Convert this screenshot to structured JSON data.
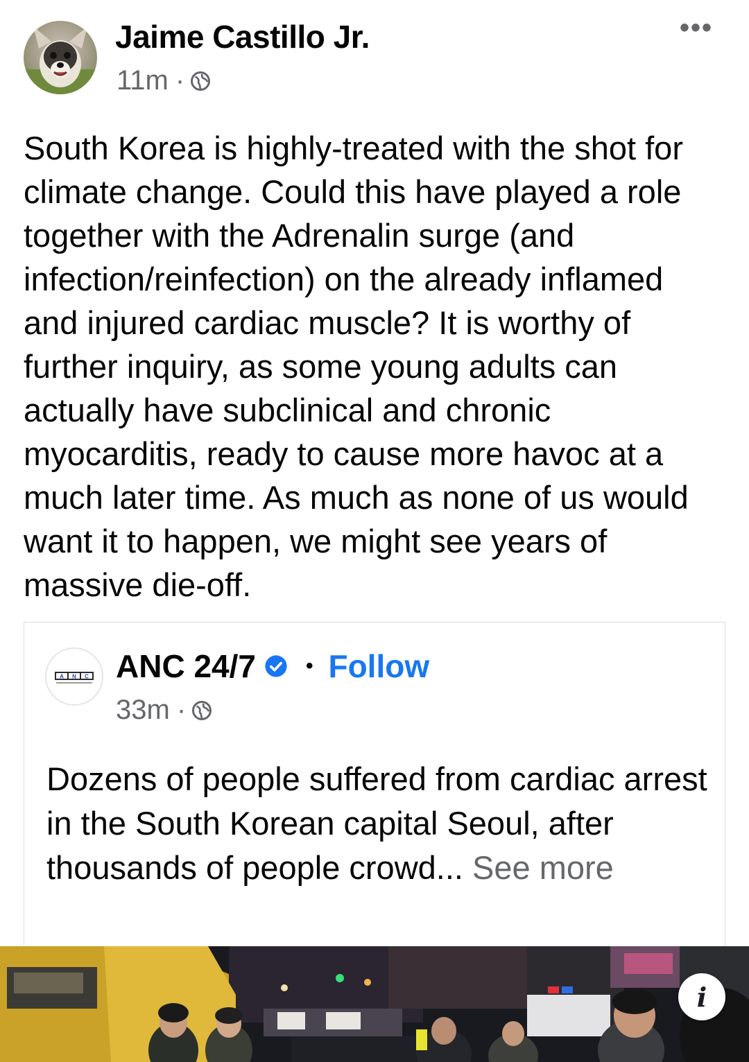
{
  "post": {
    "author": "Jaime Castillo Jr.",
    "time": "11m",
    "separator": "·",
    "more_label": "•••",
    "text": "South Korea is highly-treated with the shot for climate change. Could this have played a role together with the Adrenalin surge (and infection/reinfection) on the already inflamed and injured cardiac muscle? It is worthy of further inquiry, as some young adults can actually have subclinical and chronic myocarditis, ready to cause more havoc at a much later time. As much as none of us would want it to happen, we might see years of massive die-off."
  },
  "shared": {
    "author": "ANC 24/7",
    "logo_text": "ANC",
    "bullet": "•",
    "follow_label": "Follow",
    "time": "33m",
    "separator": "·",
    "text": "Dozens of people suffered from cardiac arrest in the South Korean capital Seoul, after thousands of people crowd...",
    "see_more": "See more"
  },
  "photo": {
    "info_label": "i"
  },
  "colors": {
    "link": "#1877f2",
    "secondary_text": "#65676b",
    "primary_text": "#050505"
  }
}
